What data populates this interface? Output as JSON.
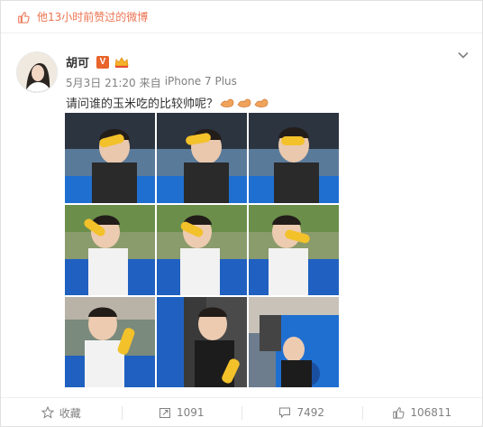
{
  "liked_bar": {
    "text": "他13小时前赞过的微博",
    "icon": "thumb-up-icon"
  },
  "post": {
    "author": {
      "name": "胡可",
      "verified_badge": "V",
      "level_badge": "crown-icon"
    },
    "meta": {
      "date": "5月3日 21:20",
      "source_prefix": "来自",
      "source": "iPhone 7 Plus"
    },
    "text": "请问谁的玉米吃的比较帅呢？",
    "emoji": [
      "muscle-arm-icon",
      "muscle-arm-icon",
      "muscle-arm-icon"
    ],
    "photo_count": 9
  },
  "actions": {
    "favorite_label": "收藏",
    "repost_count": "1091",
    "comment_count": "7492",
    "like_count": "106811"
  },
  "colors": {
    "accent": "#eb7350",
    "muted": "#808080",
    "verified": "#e8642b"
  }
}
